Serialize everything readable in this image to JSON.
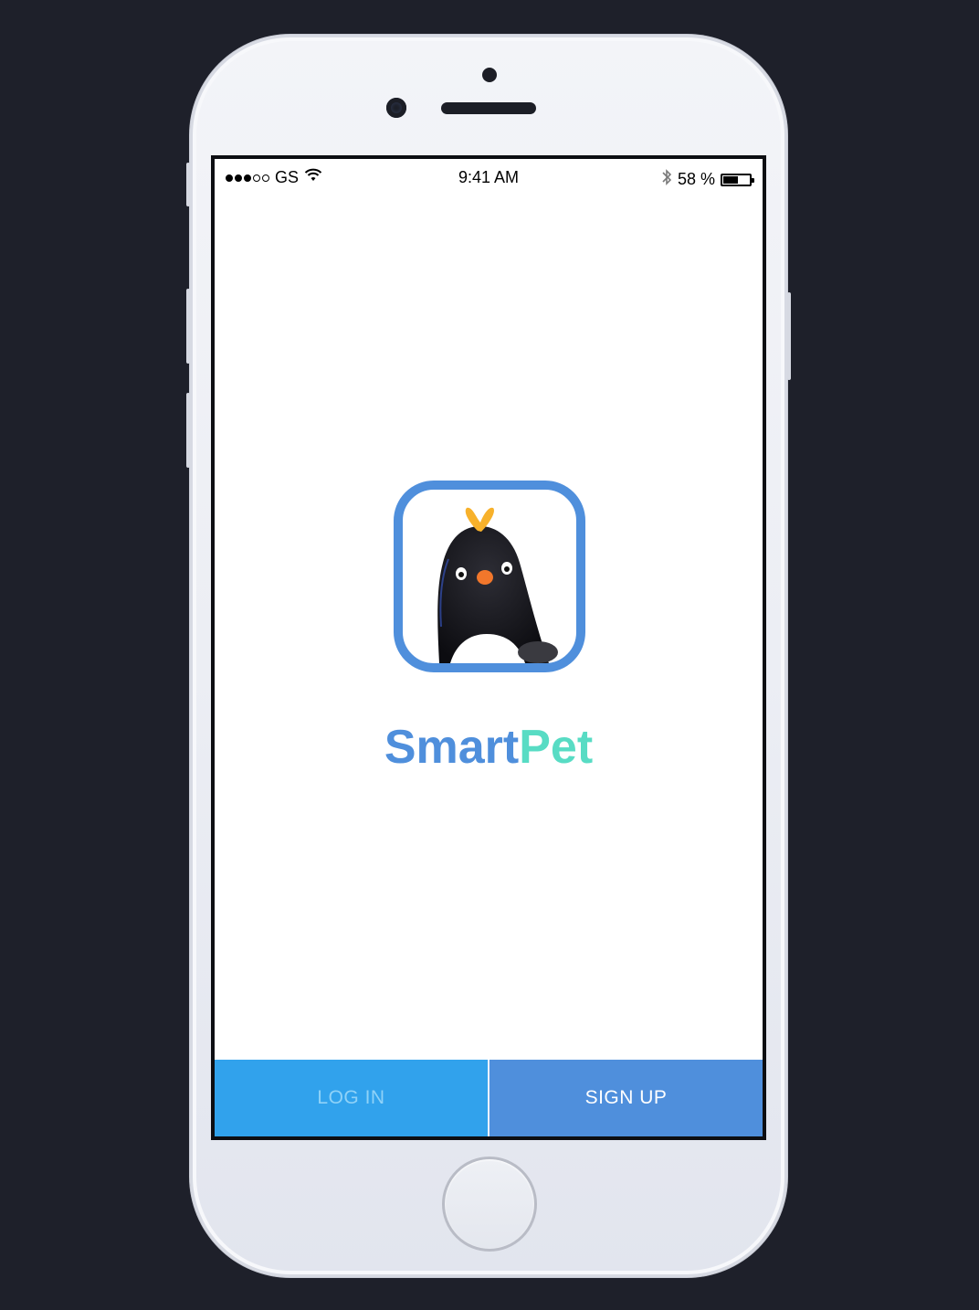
{
  "status_bar": {
    "carrier": "GS",
    "time": "9:41 AM",
    "battery_text": "58 %",
    "battery_level": 0.58,
    "signal_filled": 3,
    "signal_total": 5,
    "wifi_icon": "wifi-icon",
    "bluetooth_icon": "bluetooth-icon"
  },
  "brand": {
    "name_part1": "Smart",
    "name_part2": "Pet",
    "color_part1": "#4f8fdc",
    "color_part2": "#58dcc4",
    "icon": "penguin-app-icon"
  },
  "actions": {
    "login_label": "LOG IN",
    "signup_label": "SIGN UP",
    "login_color": "#31a2ec",
    "signup_color": "#4f8fdc"
  }
}
